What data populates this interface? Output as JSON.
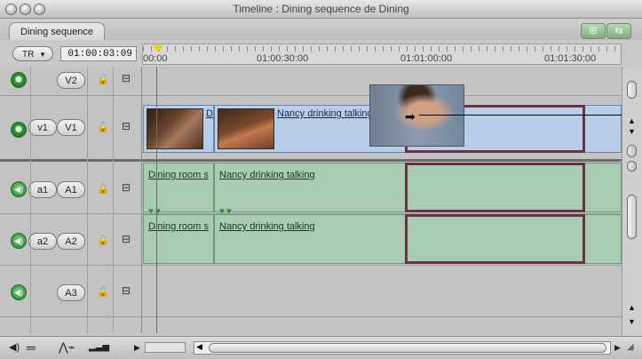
{
  "window": {
    "title": "Timeline : Dining sequence de Dining"
  },
  "tabs": [
    {
      "label": "Dining sequence"
    }
  ],
  "controls": {
    "tr_label": "TR",
    "timecode": "01:00:03:09"
  },
  "ruler": {
    "ticks": [
      "00:00",
      "01:00:30:00",
      "01:01:00:00",
      "01:01:30:00"
    ]
  },
  "tracks": {
    "v2": {
      "label": "V2"
    },
    "v1": {
      "src": "v1",
      "dst": "V1"
    },
    "a1": {
      "src": "a1",
      "dst": "A1"
    },
    "a2": {
      "src": "a2",
      "dst": "A2"
    },
    "a3": {
      "dst": "A3"
    }
  },
  "clips": {
    "v1_clip1": {
      "title": "D"
    },
    "v1_clip2": {
      "title": "Nancy drinking talking"
    },
    "a1_clip1": {
      "title": "Dining room s"
    },
    "a1_clip2": {
      "title": "Nancy drinking talking"
    },
    "a2_clip1": {
      "title": "Dining room s"
    },
    "a2_clip2": {
      "title": "Nancy drinking talking"
    }
  },
  "colors": {
    "video_clip": "#b7cde8",
    "audio_clip": "#a7ccb1",
    "selection": "#6a3340",
    "playhead": "#f2d100"
  },
  "icons": [
    "lock-icon",
    "clip-overlay-toggle-icon",
    "speaker-icon",
    "target-icon",
    "scroll-up-arrow",
    "scroll-down-arrow",
    "scroll-left-arrow",
    "scroll-right-arrow"
  ]
}
